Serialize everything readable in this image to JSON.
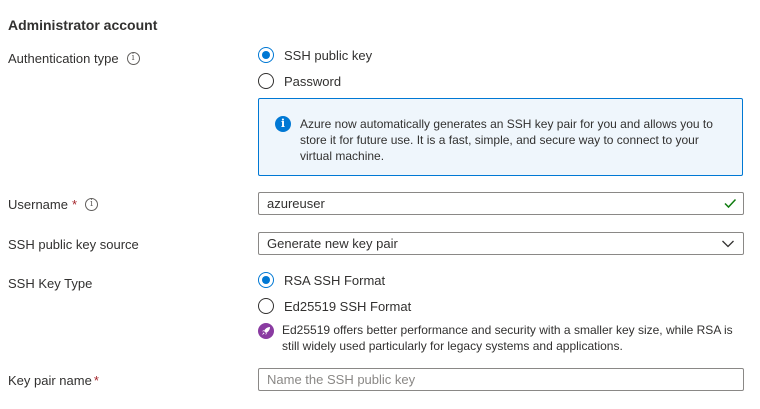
{
  "section": {
    "title": "Administrator account"
  },
  "auth": {
    "label": "Authentication type",
    "options": [
      {
        "label": "SSH public key",
        "checked": true
      },
      {
        "label": "Password",
        "checked": false
      }
    ],
    "info": "Azure now automatically generates an SSH key pair for you and allows you to store it for future use. It is a fast, simple, and secure way to connect to your virtual machine."
  },
  "username": {
    "label": "Username",
    "required": "*",
    "value": "azureuser"
  },
  "key_source": {
    "label": "SSH public key source",
    "value": "Generate new key pair"
  },
  "key_type": {
    "label": "SSH Key Type",
    "options": [
      {
        "label": "RSA SSH Format",
        "checked": true
      },
      {
        "label": "Ed25519 SSH Format",
        "checked": false
      }
    ],
    "note": "Ed25519 offers better performance and security with a smaller key size, while RSA is still widely used particularly for legacy systems and applications."
  },
  "key_pair": {
    "label": "Key pair name",
    "required": "*",
    "placeholder": "Name the SSH public key"
  },
  "colors": {
    "accent": "#0078d4",
    "valid": "#107c10",
    "rocket": "#8a3ba1",
    "required": "#a4262c"
  }
}
